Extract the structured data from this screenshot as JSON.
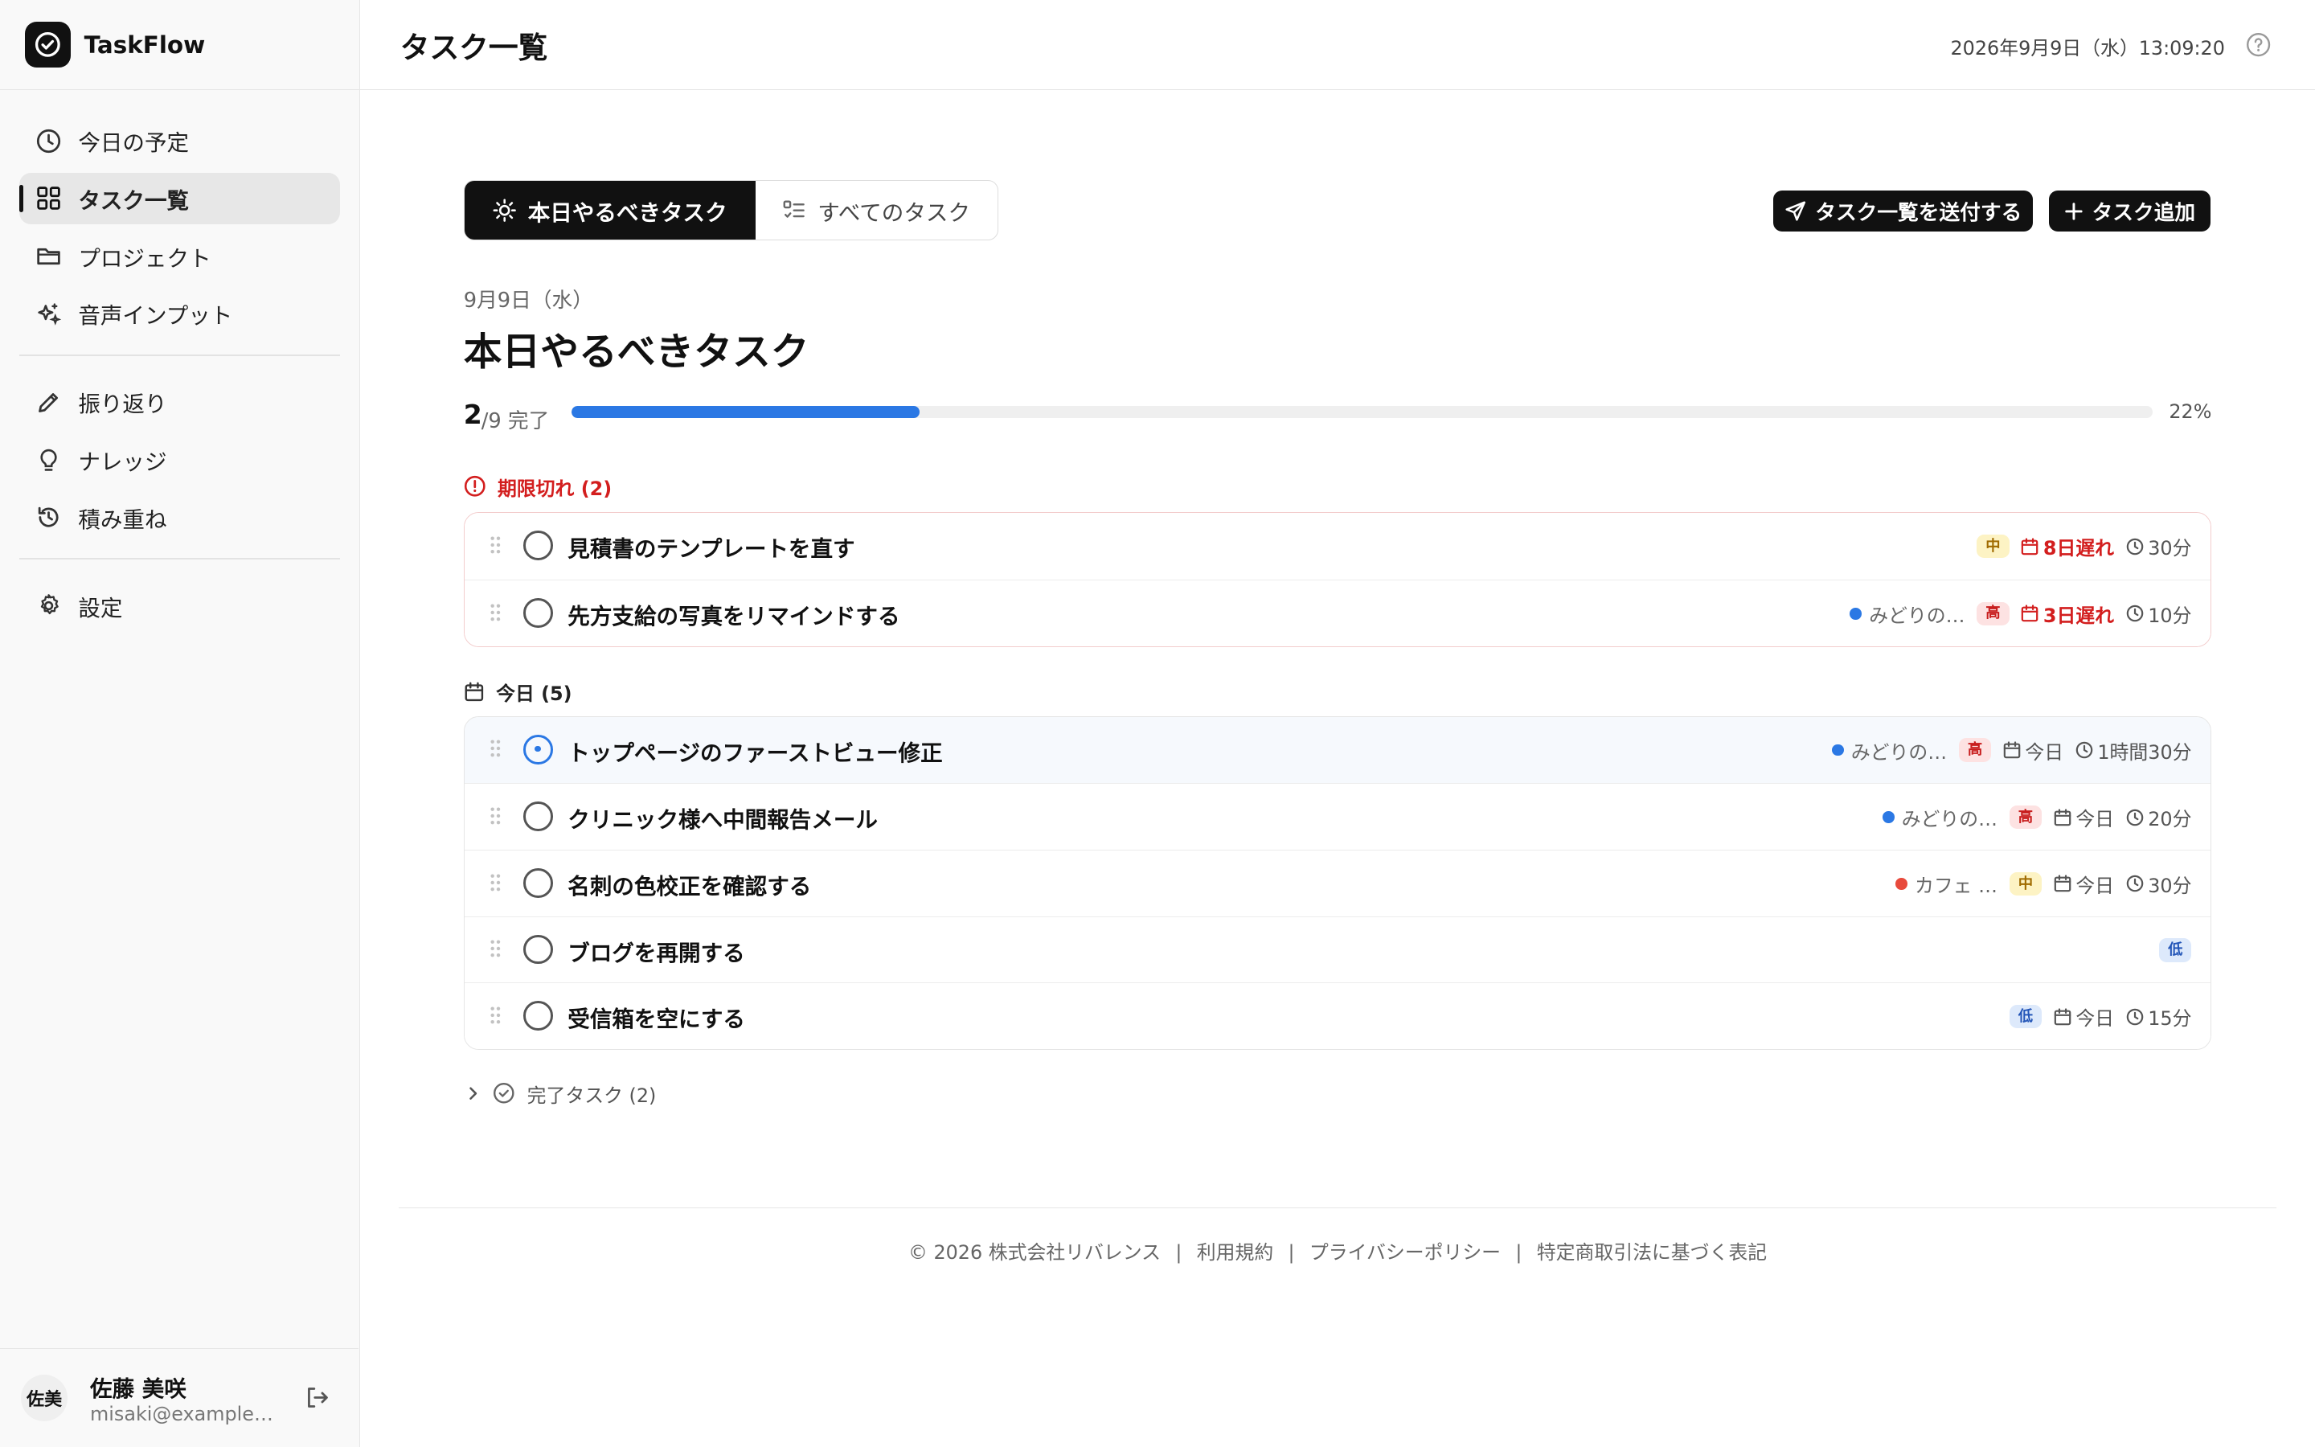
{
  "app": {
    "name": "TaskFlow"
  },
  "sidebar": {
    "items": [
      {
        "label": "今日の予定",
        "icon": "clock-icon"
      },
      {
        "label": "タスク一覧",
        "icon": "grid-icon",
        "active": true
      },
      {
        "label": "プロジェクト",
        "icon": "folder-icon"
      },
      {
        "label": "音声インプット",
        "icon": "sparkle-icon"
      },
      {
        "label": "振り返り",
        "icon": "pencil-icon"
      },
      {
        "label": "ナレッジ",
        "icon": "lightbulb-icon"
      },
      {
        "label": "積み重ね",
        "icon": "history-icon"
      },
      {
        "label": "設定",
        "icon": "gear-icon"
      }
    ]
  },
  "user": {
    "avatar": "佐美",
    "name": "佐藤 美咲",
    "email": "misaki@example.com"
  },
  "header": {
    "title": "タスク一覧",
    "datetime": "2026年9月9日（水）13:09:20"
  },
  "tabs": [
    {
      "label": "本日やるべきタスク",
      "active": true
    },
    {
      "label": "すべてのタスク",
      "active": false
    }
  ],
  "actions": {
    "send": "タスク一覧を送付する",
    "add": "タスク追加"
  },
  "section": {
    "date": "9月9日（水）",
    "title": "本日やるべきタスク"
  },
  "progress": {
    "done": "2",
    "total": "/9 完了",
    "percent_label": "22%",
    "fraction": 0.22
  },
  "overdue": {
    "label": "期限切れ (2)",
    "tasks": [
      {
        "title": "見積書のテンプレートを直す",
        "project": "",
        "project_color": "",
        "priority": "中",
        "priority_level": "mid",
        "due": "8日遅れ",
        "duration": "30分"
      },
      {
        "title": "先方支給の写真をリマインドする",
        "project": "みどりの…",
        "project_color": "#2b78e4",
        "priority": "高",
        "priority_level": "high",
        "due": "3日遅れ",
        "duration": "10分"
      }
    ]
  },
  "today": {
    "label": "今日 (5)",
    "tasks": [
      {
        "title": "トップページのファーストビュー修正",
        "project": "みどりの…",
        "project_color": "#2b78e4",
        "priority": "高",
        "priority_level": "high",
        "due": "今日",
        "duration": "1時間30分",
        "in_progress": true
      },
      {
        "title": "クリニック様へ中間報告メール",
        "project": "みどりの…",
        "project_color": "#2b78e4",
        "priority": "高",
        "priority_level": "high",
        "due": "今日",
        "duration": "20分"
      },
      {
        "title": "名刺の色校正を確認する",
        "project": "カフェ …",
        "project_color": "#e84a3c",
        "priority": "中",
        "priority_level": "mid",
        "due": "今日",
        "duration": "30分"
      },
      {
        "title": "ブログを再開する",
        "project": "",
        "project_color": "",
        "priority": "低",
        "priority_level": "low",
        "due": "",
        "duration": ""
      },
      {
        "title": "受信箱を空にする",
        "project": "",
        "project_color": "",
        "priority": "低",
        "priority_level": "low",
        "due": "今日",
        "duration": "15分"
      }
    ]
  },
  "completed": {
    "label": "完了タスク (2)"
  },
  "footer": {
    "links": [
      "© 2026 株式会社リバレンス",
      "利用規約",
      "プライバシーポリシー",
      "特定商取引法に基づく表記"
    ],
    "separator": "|"
  }
}
